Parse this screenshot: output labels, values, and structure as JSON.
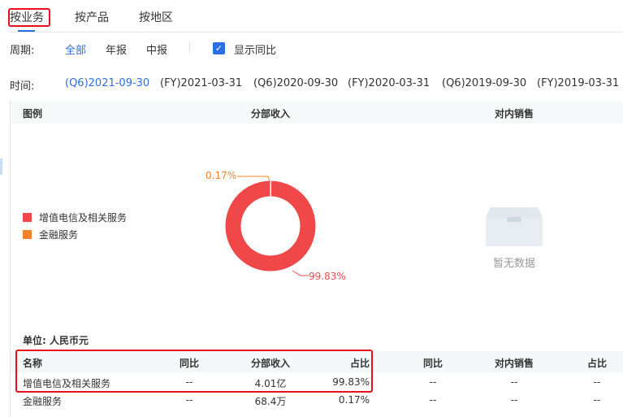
{
  "tabs": [
    {
      "label": "按业务"
    },
    {
      "label": "按产品"
    },
    {
      "label": "按地区"
    }
  ],
  "period": {
    "label": "周期:",
    "options": [
      "全部",
      "年报",
      "中报"
    ],
    "selected": "全部",
    "show_yoy_label": "显示同比",
    "show_yoy_checked": true
  },
  "time": {
    "label": "时间:",
    "options": [
      "(Q6)2021-09-30",
      "(FY)2021-03-31",
      "(Q6)2020-09-30",
      "(FY)2020-03-31",
      "(Q6)2019-09-30",
      "(FY)2019-03-31"
    ],
    "selected": "(Q6)2021-09-30"
  },
  "chart_panel": {
    "legend_title": "图例",
    "col1": "分部收入",
    "col2": "对内销售",
    "empty_text": "暂无数据"
  },
  "chart_data": {
    "type": "pie",
    "title": "分部收入",
    "categories": [
      "增值电信及相关服务",
      "金融服务"
    ],
    "values": [
      99.83,
      0.17
    ],
    "labels": [
      "99.83%",
      "0.17%"
    ],
    "colors": [
      "#f04848",
      "#f5822a"
    ]
  },
  "table": {
    "unit": "单位: 人民币元",
    "headers": [
      "名称",
      "同比",
      "分部收入",
      "占比",
      "同比",
      "对内销售",
      "占比"
    ],
    "rows": [
      [
        "增值电信及相关服务",
        "--",
        "4.01亿",
        "99.83%",
        "--",
        "--",
        "--"
      ],
      [
        "金融服务",
        "--",
        "68.4万",
        "0.17%",
        "--",
        "--",
        "--"
      ]
    ]
  },
  "colors": {
    "accent": "#2b6de5",
    "highlight": "#e8101a"
  }
}
